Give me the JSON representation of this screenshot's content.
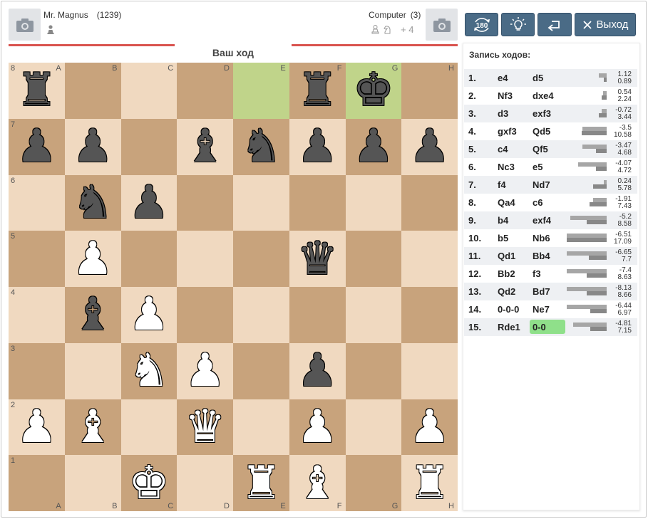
{
  "players": {
    "white": {
      "name": "Mr. Magnus",
      "rating": "(1239)",
      "icon": "pawn-icon"
    },
    "black": {
      "name": "Computer",
      "rating": "(3)",
      "material": "+ 4",
      "captured_icons": [
        "pawn-icon",
        "knight-icon"
      ]
    }
  },
  "status": {
    "turn": "Ваш ход"
  },
  "buttons": {
    "rotate": "180",
    "exit": "Выход"
  },
  "colors": {
    "accent": "#d9534f",
    "button": "#4a6b86",
    "light_square": "#f0d9c0",
    "dark_square": "#c8a37c",
    "highlight": "#c0d48a",
    "current_move": "#8fe08a"
  },
  "board": {
    "files": [
      "A",
      "B",
      "C",
      "D",
      "E",
      "F",
      "G",
      "H"
    ],
    "ranks": [
      "8",
      "7",
      "6",
      "5",
      "4",
      "3",
      "2",
      "1"
    ],
    "position": [
      [
        "bR",
        "",
        "",
        "",
        "",
        "bR",
        "bK",
        ""
      ],
      [
        "bP",
        "bP",
        "",
        "bB",
        "bN",
        "bP",
        "bP",
        "bP"
      ],
      [
        "",
        "bN",
        "bP",
        "",
        "",
        "",
        "",
        ""
      ],
      [
        "",
        "wP",
        "",
        "",
        "",
        "bQ",
        "",
        ""
      ],
      [
        "",
        "bB",
        "wP",
        "",
        "",
        "",
        "",
        ""
      ],
      [
        "",
        "",
        "wN",
        "wP",
        "",
        "bP",
        "",
        ""
      ],
      [
        "wP",
        "wB",
        "",
        "wQ",
        "",
        "wP",
        "",
        "wP"
      ],
      [
        "",
        "",
        "wK",
        "",
        "wR",
        "wB",
        "",
        "wR"
      ]
    ],
    "highlighted": [
      "e8",
      "g8"
    ]
  },
  "moves_panel": {
    "title": "Запись ходов:",
    "moves": [
      {
        "num": "1.",
        "white": "e4",
        "black": "d5",
        "eval1": "1.12",
        "eval2": "0.89"
      },
      {
        "num": "2.",
        "white": "Nf3",
        "black": "dxe4",
        "eval1": "0.54",
        "eval2": "2.24"
      },
      {
        "num": "3.",
        "white": "d3",
        "black": "exf3",
        "eval1": "-0.72",
        "eval2": "3.44"
      },
      {
        "num": "4.",
        "white": "gxf3",
        "black": "Qd5",
        "eval1": "-3.5",
        "eval2": "10.58"
      },
      {
        "num": "5.",
        "white": "c4",
        "black": "Qf5",
        "eval1": "-3.47",
        "eval2": "4.68"
      },
      {
        "num": "6.",
        "white": "Nc3",
        "black": "e5",
        "eval1": "-4.07",
        "eval2": "4.72"
      },
      {
        "num": "7.",
        "white": "f4",
        "black": "Nd7",
        "eval1": "0.24",
        "eval2": "5.78"
      },
      {
        "num": "8.",
        "white": "Qa4",
        "black": "c6",
        "eval1": "-1.91",
        "eval2": "7.43"
      },
      {
        "num": "9.",
        "white": "b4",
        "black": "exf4",
        "eval1": "-5.2",
        "eval2": "8.58"
      },
      {
        "num": "10.",
        "white": "b5",
        "black": "Nb6",
        "eval1": "-6.51",
        "eval2": "17.09"
      },
      {
        "num": "11.",
        "white": "Qd1",
        "black": "Bb4",
        "eval1": "-6.65",
        "eval2": "7.7"
      },
      {
        "num": "12.",
        "white": "Bb2",
        "black": "f3",
        "eval1": "-7.4",
        "eval2": "8.63"
      },
      {
        "num": "13.",
        "white": "Qd2",
        "black": "Bd7",
        "eval1": "-8.13",
        "eval2": "8.66"
      },
      {
        "num": "14.",
        "white": "0-0-0",
        "black": "Ne7",
        "eval1": "-6.44",
        "eval2": "6.97"
      },
      {
        "num": "15.",
        "white": "Rde1",
        "black": "0-0",
        "eval1": "-4.81",
        "eval2": "7.15",
        "current": true
      }
    ]
  }
}
